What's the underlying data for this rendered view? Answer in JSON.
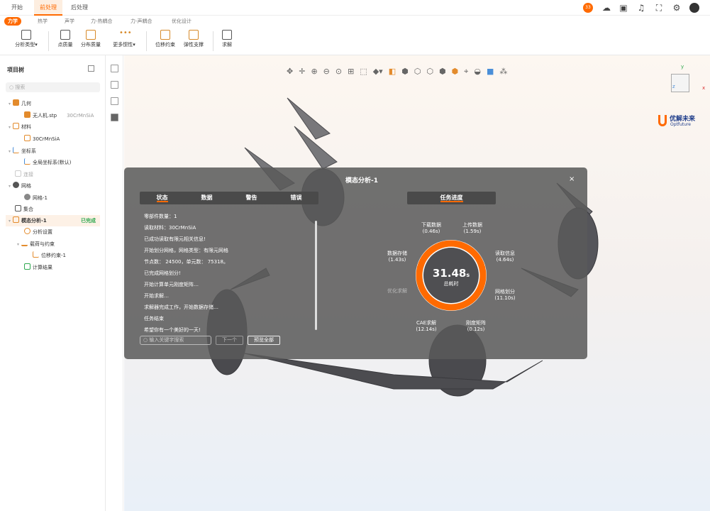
{
  "menu_tabs": [
    "开始",
    "前处理",
    "后处理"
  ],
  "active_menu": "前处理",
  "user_badge": "33",
  "ribbon_tabs": [
    "力学",
    "热学",
    "声学",
    "力-热耦合",
    "力-声耦合",
    "优化设计"
  ],
  "ribbon_buttons": {
    "analysis_type": "分析类型",
    "point_mass": "点质量",
    "distributed_mass": "分布质量",
    "more_properties": "更多惯性",
    "displacement": "位移约束",
    "elastic_support": "弹性支撑",
    "solve": "求解"
  },
  "tree": {
    "title": "项目树",
    "search_placeholder": "搜索",
    "items": [
      {
        "label": "几何",
        "extra": ""
      },
      {
        "label": "无人机.stp",
        "extra": "30CrMnSiA"
      },
      {
        "label": "材料",
        "extra": ""
      },
      {
        "label": "30CrMnSiA",
        "extra": ""
      },
      {
        "label": "坐标系",
        "extra": ""
      },
      {
        "label": "全局坐标系(默认)",
        "extra": ""
      },
      {
        "label": "连接",
        "extra": ""
      },
      {
        "label": "网格",
        "extra": ""
      },
      {
        "label": "网格-1",
        "extra": ""
      },
      {
        "label": "集合",
        "extra": ""
      },
      {
        "label": "模态分析-1",
        "extra": "已完成"
      },
      {
        "label": "分析设置",
        "extra": ""
      },
      {
        "label": "载荷与约束",
        "extra": ""
      },
      {
        "label": "位移约束-1",
        "extra": ""
      },
      {
        "label": "计算结果",
        "extra": ""
      }
    ]
  },
  "logo": {
    "text": "优解未来",
    "sub": "Optfuture"
  },
  "axis": {
    "x": "x",
    "y": "y",
    "z": "z"
  },
  "dialog": {
    "title": "模态分析-1",
    "tabs": [
      "状态",
      "数据",
      "警告",
      "错误"
    ],
    "progress_tab": "任务进度",
    "log": [
      "零部件数量：1",
      "读取材料：30CrMnSiA",
      "已成功读取有限元相关信息!",
      "开始划分网格，网格类型：有限元网格",
      "节点数： 24500，单元数： 75318。",
      "已完成网格划分!",
      "开始计算单元刚度矩阵…",
      "开始求解…",
      "求解器完成工作，开始数据存储…",
      "任务结束",
      "希望你有一个美好的一天!"
    ],
    "search_placeholder": "输入关键字搜索",
    "next_label": "下一个",
    "preview_all": "预览全部",
    "total_time": "31.48",
    "total_unit": "s",
    "total_label": "总耗时",
    "stages": [
      {
        "name": "下载数据",
        "time": "(0.46s)"
      },
      {
        "name": "上传数据",
        "time": "(1.59s)"
      },
      {
        "name": "读取信息",
        "time": "(4.64s)"
      },
      {
        "name": "网格划分",
        "time": "(11.10s)"
      },
      {
        "name": "刚度矩阵",
        "time": "(0.12s)"
      },
      {
        "name": "CAE求解",
        "time": "(12.14s)"
      },
      {
        "name": "优化求解",
        "time": ""
      },
      {
        "name": "数据存储",
        "time": "(1.43s)"
      }
    ]
  }
}
